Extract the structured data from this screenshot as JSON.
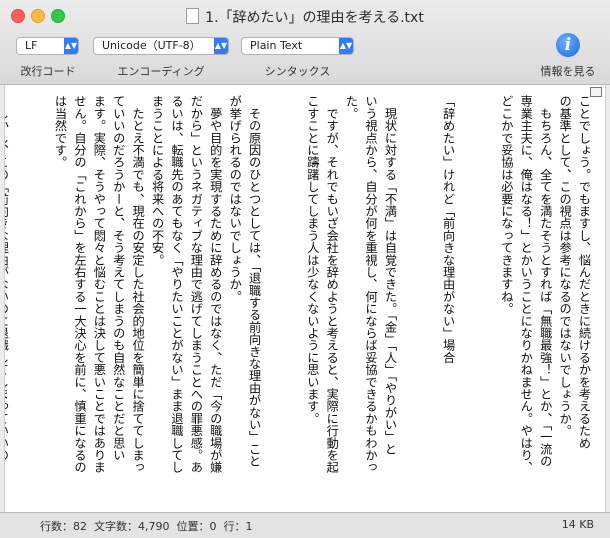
{
  "window": {
    "title": "1.「辞めたい」の理由を考える.txt"
  },
  "toolbar": {
    "line_ending": {
      "value": "LF",
      "label": "改行コード"
    },
    "encoding": {
      "value": "Unicode（UTF-8）",
      "label": "エンコーディング"
    },
    "syntax": {
      "value": "Plain Text",
      "label": "シンタックス"
    },
    "info": {
      "icon": "i",
      "label": "情報を見る"
    }
  },
  "document": {
    "text": "ことでしょう。でもますし、悩んだときに続けるかを考えるため\nの基準として、この視点は参考になるのではないでしょうか。\n　もちろん、全てを満たそうとすれば「無職最強！」とか、「一流の\n専業主夫に、俺はなる！」とかいうことになりかねません。やはり、\nどこかで妥協は必要になってきますね。\n\n\n「辞めたい」けれど「前向きな理由がない」場合\n\n\n　現状に対する「不満」は自覚できた。「金」「人」「やりがい」と\nいう視点から、自分が何を重視し、何にならば妥協できるかもわかっ\nた。\n　ですが、それでもいざ会社を辞めようと考えると、実際に行動を起\nこすことに躊躇してしまう人は少なくないように思います。\n\n\n　その原因のひとつとしては、「退職する前向きな理由がない」こと\nが挙げられるのではないでしょうか。\n　夢や目的を実現するために辞めるのではなく、ただ「今の職場が嫌\nだから」というネガティブな理由で逃げてしまうことへの罪悪感。あ\nるいは、転職先のあてもなく「やりたいことがない」まま退職してし\nまうことによる将来への不安。\n　たとえ不満でも、現在の安定した社会的地位を簡単に捨ててしまっ\nていいのだろうかーと、そう考えてしまうのも自然なことだと思い\nます。実際、そうやって悶々と悩むことは決して悪いことではありま\nせん。自分の「これから」を左右する一大決心を前に、慎重になるの\nは当然です。\n\n\n　しかし、この「前向きな理由がないのに退職してしまっていいの\nか」という問いに答えるのは困難でもあります。\n"
  },
  "status": {
    "lines": "行数：82",
    "chars": "文字数：4,790",
    "position": "位置：0",
    "row": "行：1",
    "size": "14 KB"
  }
}
